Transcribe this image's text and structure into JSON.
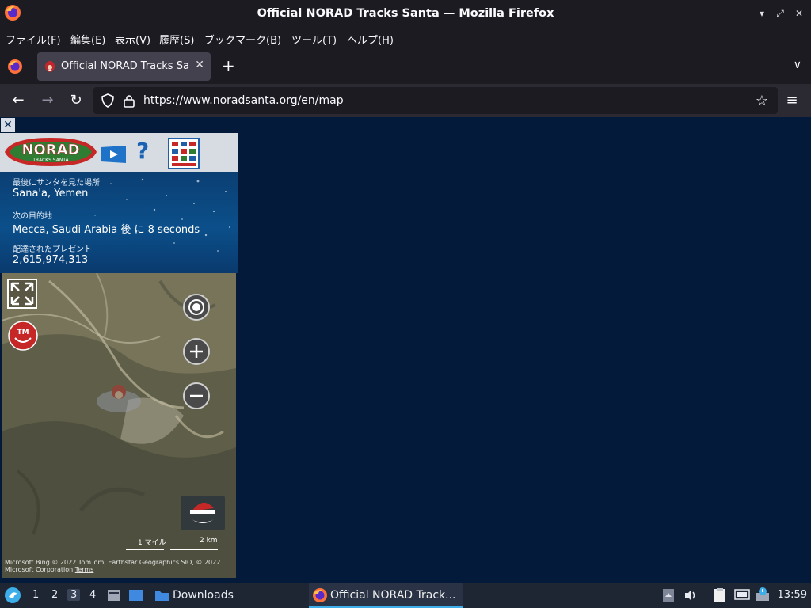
{
  "window": {
    "title": "Official NORAD Tracks Santa — Mozilla Firefox",
    "icon": "firefox-logo-icon"
  },
  "menubar": {
    "items": [
      {
        "label": "ファイル(F)"
      },
      {
        "label": "編集(E)"
      },
      {
        "label": "表示(V)"
      },
      {
        "label": "履歴(S)"
      },
      {
        "label": "ブックマーク(B)"
      },
      {
        "label": "ツール(T)"
      },
      {
        "label": "ヘルプ(H)"
      }
    ]
  },
  "tabs": {
    "active_title": "Official NORAD Tracks Santa",
    "new_tab_symbol": "+",
    "close_symbol": "✕"
  },
  "navbar": {
    "url": "https://www.noradsanta.org/en/map"
  },
  "page": {
    "close_symbol": "✕",
    "help_symbol": "?",
    "last_seen_label": "最後にサンタを見た場所",
    "last_seen_value": "Sana'a, Yemen",
    "next_stop_label": "次の目的地",
    "next_stop_value": "Mecca, Saudi Arabia 後 に 8 seconds",
    "presents_label": "配達されたプレゼント",
    "presents_value": "2,615,974,313",
    "map": {
      "scale_miles": "1 マイル",
      "scale_km": "2 km",
      "attribution": "© 2022 TomTom, Earthstar Geographics SIO, © 2022 Microsoft Corporation",
      "terms": "Terms",
      "provider": "Microsoft Bing"
    }
  },
  "taskbar": {
    "workspaces": [
      "1",
      "2",
      "3",
      "4"
    ],
    "active_workspace": "3",
    "downloads_label": "Downloads",
    "task_label": "Official NORAD Track...",
    "clock": "13:59"
  },
  "colors": {
    "page_background": "#031a3b",
    "panel_blue": "#0b4f8a",
    "chrome_dark": "#1c1b22",
    "toolbar": "#2b2a33"
  }
}
